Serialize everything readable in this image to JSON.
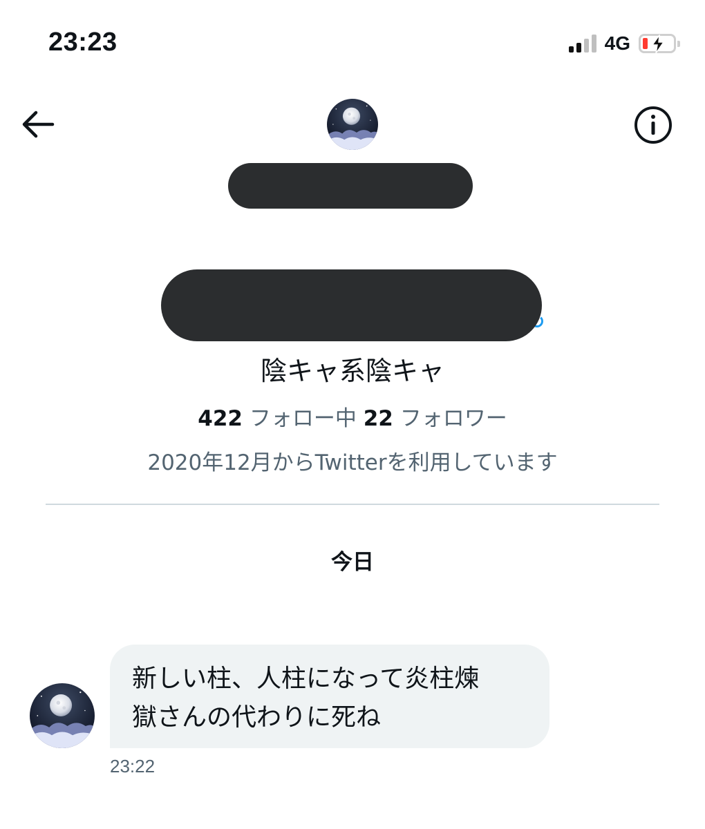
{
  "status_bar": {
    "time": "23:23",
    "network": "4G",
    "signal_bars": 2,
    "signal_bars_total": 4,
    "battery": "low-charging"
  },
  "header": {
    "back_icon": "arrow-left-icon",
    "info_icon": "info-circle-icon",
    "avatar": "moon-clouds-avatar"
  },
  "profile": {
    "name_redacted": true,
    "handle_redacted": true,
    "bio": "陰キャ系陰キャ",
    "following_count": "422",
    "following_label": " フォロー中 ",
    "followers_count": "22",
    "followers_label": " フォロワー",
    "joined": "2020年12月からTwitterを利用しています"
  },
  "conversation": {
    "date_separator": "今日",
    "messages": [
      {
        "line1": "新しい柱、人柱になって炎柱煉",
        "line2": "獄さんの代わりに死ね",
        "time": "23:22"
      }
    ]
  },
  "colors": {
    "text_primary": "#0f1419",
    "text_secondary": "#536471",
    "bubble_bg": "#eff3f4",
    "divider": "#cfd9de",
    "redaction": "#2b2d2f",
    "battery_low": "#ff3b30"
  }
}
